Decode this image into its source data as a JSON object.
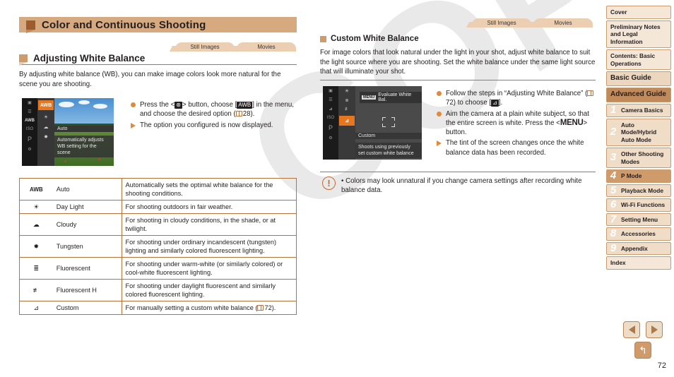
{
  "chapter": {
    "title": "Color and Continuous Shooting"
  },
  "tabs": {
    "still": "Still Images",
    "movies": "Movies"
  },
  "left": {
    "section_title": "Adjusting White Balance",
    "intro": "By adjusting white balance (WB), you can make image colors look more natural for the scene you are shooting.",
    "camera_screen": {
      "row_label": "Auto",
      "desc_line1": "Automatically adjusts",
      "desc_line2": "WB setting for the scene",
      "selected_icon": "AWB",
      "left_icons": [
        "▶",
        "☰",
        "AWB",
        "ISO",
        "P",
        "⚙"
      ],
      "col2_icons": [
        "AWB",
        "☀",
        "☁",
        "☀"
      ]
    },
    "steps": [
      {
        "type": "dot",
        "text_a": "Press the <",
        "kbd": "FUNC SET",
        "text_b": "> button, choose [",
        "kbd2": "AWB",
        "text_c": "] in the menu, and choose the desired option (",
        "page": "28",
        "text_d": ")."
      },
      {
        "type": "tri",
        "text_a": "The option you configured is now displayed.",
        "kbd": "",
        "text_b": "",
        "kbd2": "",
        "text_c": "",
        "page": "",
        "text_d": ""
      }
    ],
    "table": {
      "rows": [
        {
          "icon": "AWB",
          "name": "Auto",
          "desc": "Automatically sets the optimal white balance for the shooting conditions."
        },
        {
          "icon": "sun",
          "name": "Day Light",
          "desc": "For shooting outdoors in fair weather."
        },
        {
          "icon": "cloud",
          "name": "Cloudy",
          "desc": "For shooting in cloudy conditions, in the shade, or at twilight."
        },
        {
          "icon": "bulb",
          "name": "Tungsten",
          "desc": "For shooting under ordinary incandescent (tungsten) lighting and similarly colored fluorescent lighting."
        },
        {
          "icon": "fluor",
          "name": "Fluorescent",
          "desc": "For shooting under warm-white (or similarly colored) or cool-white fluorescent lighting."
        },
        {
          "icon": "fluorh",
          "name": "Fluorescent H",
          "desc": "For shooting under daylight fluorescent and similarly colored fluorescent lighting."
        },
        {
          "icon": "custom",
          "name": "Custom",
          "desc_a": "For manually setting a custom white balance (",
          "page": "72",
          "desc_b": ")."
        }
      ]
    }
  },
  "right": {
    "section_title": "Custom White Balance",
    "intro": "For image colors that look natural under the light in your shot, adjust white balance to suit the light source where you are shooting. Set the white balance under the same light source that will illuminate your shot.",
    "camera_screen": {
      "top_label": "Evaluate White Bal.",
      "top_badge": "MENU",
      "row_label": "Custom",
      "desc_line1": "Shoots using previously",
      "desc_line2": "set custom white balance",
      "left_icons": [
        "▶",
        "☰",
        "☒",
        "ISO",
        "P",
        "⚙"
      ],
      "col2_icons": [
        "☀",
        "AWB",
        "AWB",
        "☒"
      ]
    },
    "steps": [
      {
        "type": "dot",
        "text_a": "Follow the steps in “Adjusting White Balance” (",
        "page": "72",
        "text_b": ") to choose [",
        "kbd": "custom",
        "text_c": "]."
      },
      {
        "type": "dot",
        "text_a": "Aim the camera at a plain white subject, so that the entire screen is white. Press the <",
        "kbd": "MENU",
        "text_b": "> button.",
        "page": "",
        "text_c": ""
      },
      {
        "type": "tri",
        "text_a": "The tint of the screen changes once the white balance data has been recorded.",
        "kbd": "",
        "text_b": "",
        "page": "",
        "text_c": ""
      }
    ],
    "caution": {
      "text": "Colors may look unnatural if you change camera settings after recording white balance data."
    }
  },
  "sidebar": {
    "items": [
      {
        "label": "Cover",
        "num": "",
        "style": "plain"
      },
      {
        "label": "Preliminary Notes and Legal Information",
        "num": "",
        "style": "plain"
      },
      {
        "label": "Contents: Basic Operations",
        "num": "",
        "style": "plain"
      },
      {
        "label": "Basic Guide",
        "num": "",
        "style": "big"
      },
      {
        "label": "Advanced Guide",
        "num": "",
        "style": "adv"
      },
      {
        "label": "Camera Basics",
        "num": "1",
        "style": "num"
      },
      {
        "label": "Auto Mode/Hybrid Auto Mode",
        "num": "2",
        "style": "num"
      },
      {
        "label": "Other Shooting Modes",
        "num": "3",
        "style": "num"
      },
      {
        "label": "P Mode",
        "num": "4",
        "style": "num active"
      },
      {
        "label": "Playback Mode",
        "num": "5",
        "style": "num"
      },
      {
        "label": "Wi-Fi Functions",
        "num": "6",
        "style": "num"
      },
      {
        "label": "Setting Menu",
        "num": "7",
        "style": "num"
      },
      {
        "label": "Accessories",
        "num": "8",
        "style": "num"
      },
      {
        "label": "Appendix",
        "num": "9",
        "style": "num"
      },
      {
        "label": "Index",
        "num": "",
        "style": "plain"
      }
    ]
  },
  "footer": {
    "prev_icon": "left-arrow",
    "next_icon": "right-arrow",
    "return_icon": "return-arrow",
    "page_number": "72"
  },
  "watermark": {
    "text": "COPY"
  },
  "colors": {
    "accent": "#b8713a",
    "bar": "#d7a97f",
    "active_nav": "#cf9b6b",
    "nav_bg": "#f0ddc8",
    "orange_bullet": "#e08a3c"
  }
}
